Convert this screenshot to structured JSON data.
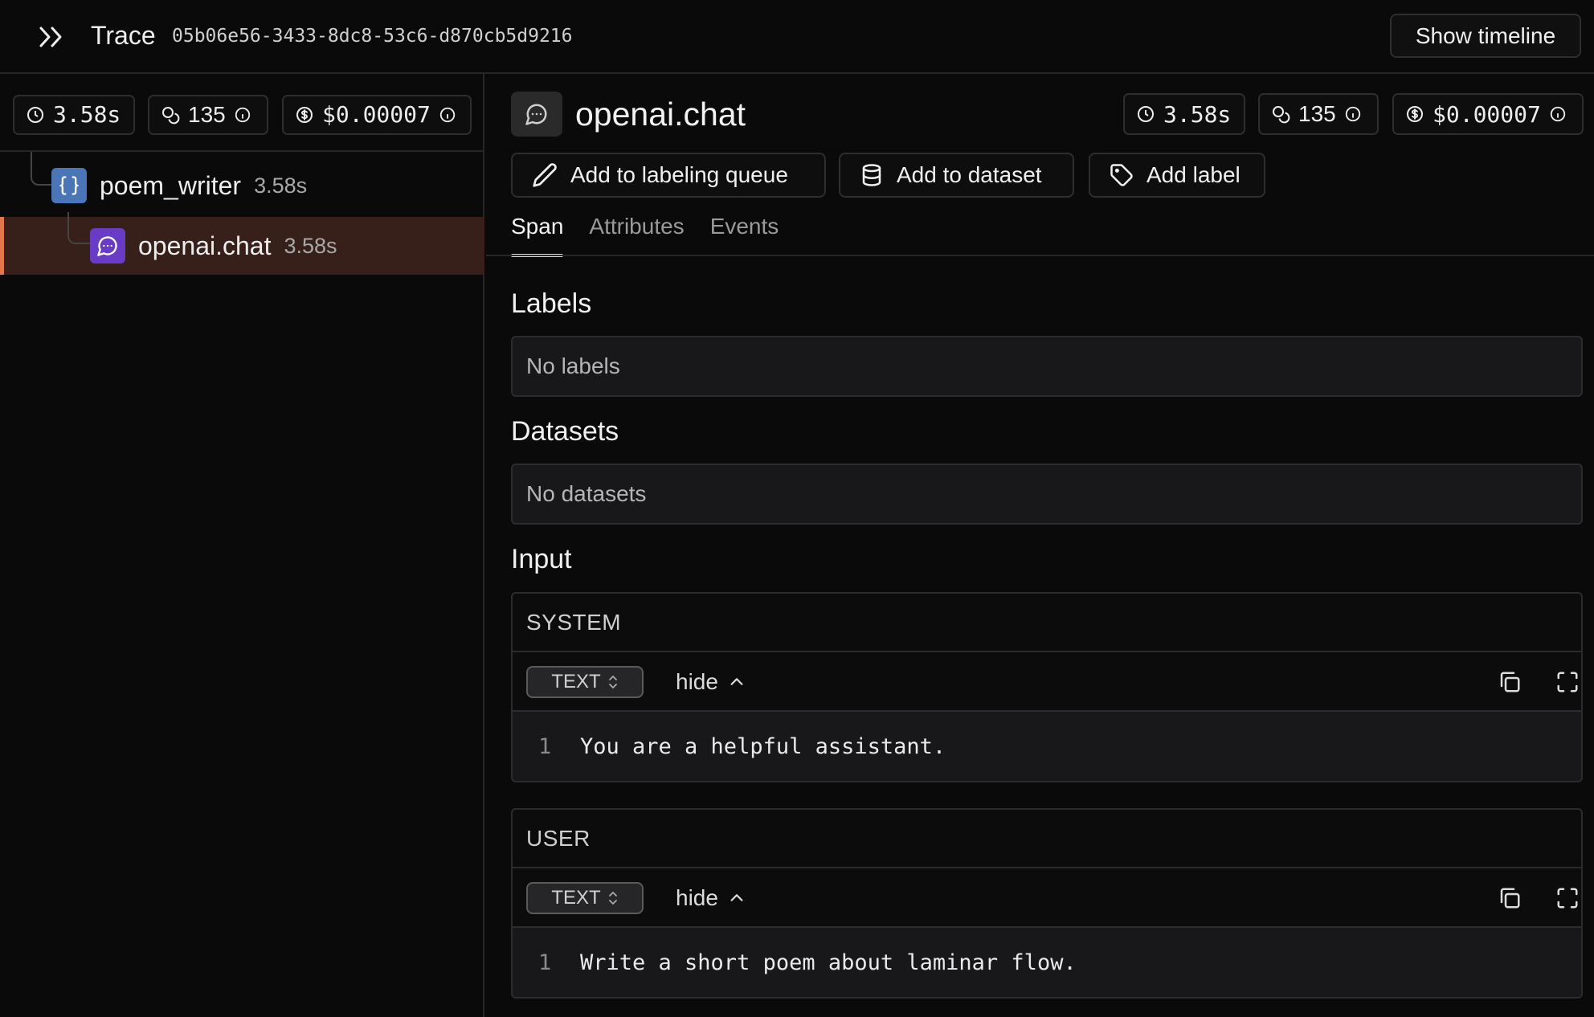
{
  "header": {
    "title": "Trace",
    "trace_id": "05b06e56-3433-8dc8-53c6-d870cb5d9216",
    "show_timeline_label": "Show timeline"
  },
  "summary": {
    "duration": "3.58s",
    "tokens": "135",
    "cost": "$0.00007"
  },
  "tree": [
    {
      "name": "poem_writer",
      "duration": "3.58s",
      "icon": "braces-icon",
      "color": "#4a76b8"
    },
    {
      "name": "openai.chat",
      "duration": "3.58s",
      "icon": "chat-icon",
      "color": "#6a3bc4",
      "selected": true
    }
  ],
  "span": {
    "title": "openai.chat",
    "duration": "3.58s",
    "tokens": "135",
    "cost": "$0.00007",
    "actions": {
      "labeling_queue": "Add to labeling queue",
      "dataset": "Add to dataset",
      "label": "Add label"
    },
    "tabs": [
      "Span",
      "Attributes",
      "Events"
    ],
    "labels_heading": "Labels",
    "labels_empty": "No labels",
    "datasets_heading": "Datasets",
    "datasets_empty": "No datasets",
    "input_heading": "Input",
    "messages": [
      {
        "role": "SYSTEM",
        "format": "TEXT",
        "toggle": "hide",
        "line": "1",
        "content": "You are a helpful assistant."
      },
      {
        "role": "USER",
        "format": "TEXT",
        "toggle": "hide",
        "line": "1",
        "content": "Write a short poem about laminar flow."
      }
    ]
  },
  "colors": {
    "selected_row_bg": "#362019",
    "selected_accent": "#e4764b"
  }
}
